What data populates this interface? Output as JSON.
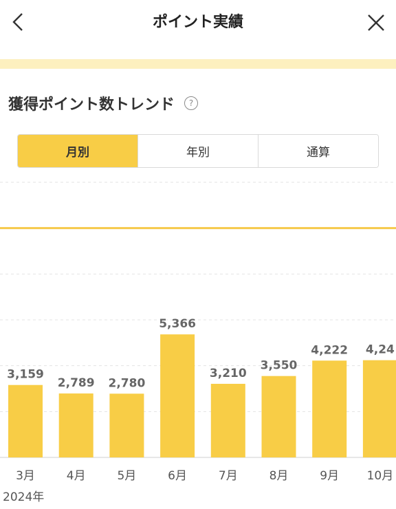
{
  "header": {
    "title": "ポイント実績",
    "back_icon": "chevron-left-icon",
    "close_icon": "close-icon"
  },
  "section": {
    "title": "獲得ポイント数トレンド",
    "help_icon": "help-circle-icon",
    "help_glyph": "?"
  },
  "tabs": [
    {
      "label": "月別",
      "active": true
    },
    {
      "label": "年別",
      "active": false
    },
    {
      "label": "通算",
      "active": false
    }
  ],
  "colors": {
    "accent": "#f8cd46",
    "band": "#fdf0bf",
    "target_line": "#f6c94a",
    "grid": "#e3e3e3",
    "value_label": "#666666",
    "axis_label": "#555555"
  },
  "chart_data": {
    "type": "bar",
    "categories": [
      "3月",
      "4月",
      "5月",
      "6月",
      "7月",
      "8月",
      "9月",
      "10月"
    ],
    "values": [
      3159,
      2789,
      2780,
      5366,
      3210,
      3550,
      4222,
      4240
    ],
    "value_labels": [
      "3,159",
      "2,789",
      "2,780",
      "5,366",
      "3,210",
      "3,550",
      "4,222",
      "4,24"
    ],
    "category_labels": [
      "3月",
      "4月",
      "5月",
      "6月",
      "7月",
      "8月",
      "9月",
      "10月"
    ],
    "year_label": "2024年",
    "ylim": [
      0,
      12000
    ],
    "reference_line": 10000,
    "grid": true
  }
}
